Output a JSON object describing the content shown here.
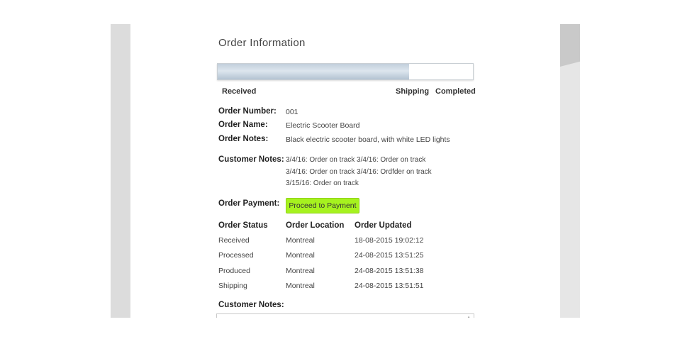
{
  "title": "Order Information",
  "progress": {
    "fraction": 0.75
  },
  "stages": [
    "Received",
    "Shipping",
    "Completed"
  ],
  "order": {
    "number_label": "Order Number:",
    "number": "001",
    "name_label": "Order Name:",
    "name": "Electric Scooter Board",
    "notes_label": "Order Notes:",
    "notes": "Black electric scooter board, with white LED lights",
    "customer_notes_label": "Customer Notes:",
    "customer_notes": [
      "3/4/16: Order on track 3/4/16: Order on track",
      "3/4/16: Order on track 3/4/16: Ordfder on track",
      "3/15/16: Order on track"
    ],
    "payment_label": "Order Payment:",
    "payment_button": "Proceed to Payment"
  },
  "status_table": {
    "headers": [
      "Order Status",
      "Order Location",
      "Order Updated"
    ],
    "rows": [
      [
        "Received",
        "Montreal",
        "18-08-2015 19:02:12"
      ],
      [
        "Processed",
        "Montreal",
        "24-08-2015 13:51:25"
      ],
      [
        "Produced",
        "Montreal",
        "24-08-2015 13:51:38"
      ],
      [
        "Shipping",
        "Montreal",
        "24-08-2015 13:51:51"
      ]
    ]
  },
  "customer_notes_field_label": "Customer Notes:",
  "colors": {
    "accent_button": "#a6f21f",
    "progress_fill": "#c2cfdc"
  }
}
